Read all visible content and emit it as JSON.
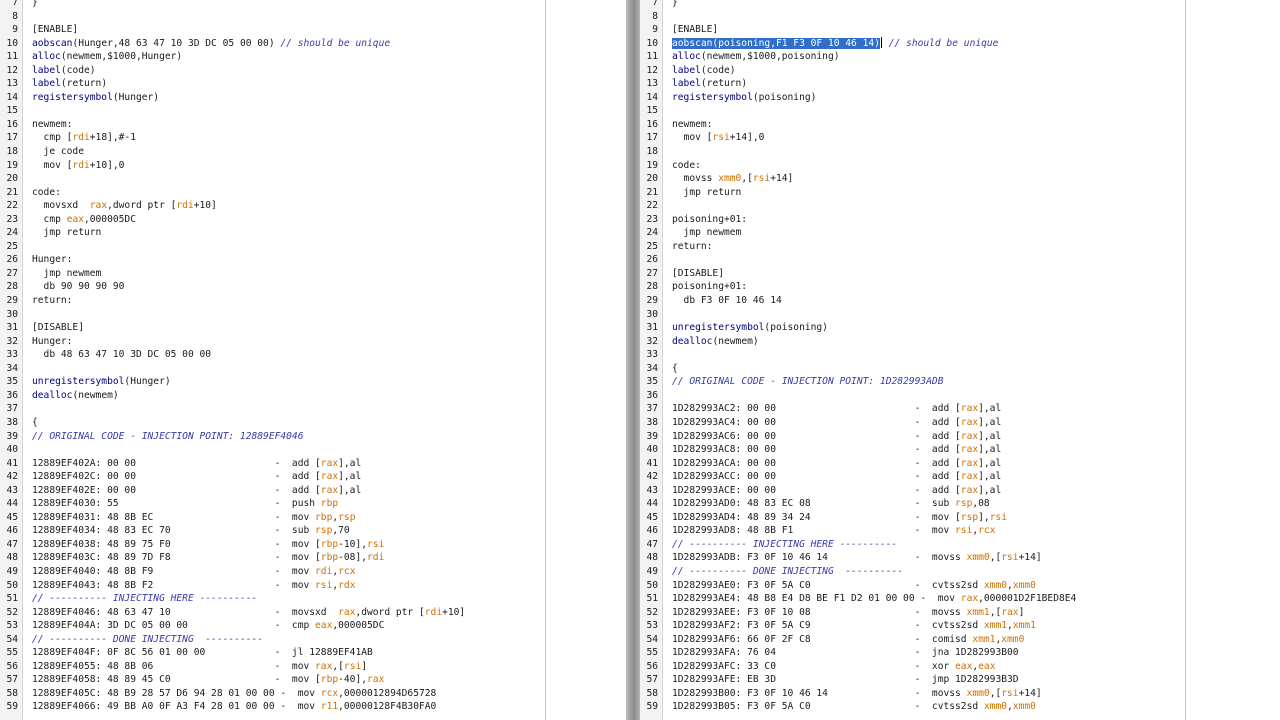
{
  "left_editor": {
    "lines": [
      {
        "n": "7",
        "t": "}"
      },
      {
        "n": "8",
        "t": ""
      },
      {
        "n": "9",
        "t": "[ENABLE]"
      },
      {
        "n": "10",
        "t": "aobscan(Hunger,48 63 47 10 3D DC 05 00 00) // should be unique"
      },
      {
        "n": "11",
        "t": "alloc(newmem,$1000,Hunger)"
      },
      {
        "n": "12",
        "t": "label(code)"
      },
      {
        "n": "13",
        "t": "label(return)"
      },
      {
        "n": "14",
        "t": "registersymbol(Hunger)"
      },
      {
        "n": "15",
        "t": ""
      },
      {
        "n": "16",
        "t": "newmem:"
      },
      {
        "n": "17",
        "t": "  cmp [rdi+18],#-1"
      },
      {
        "n": "18",
        "t": "  je code"
      },
      {
        "n": "19",
        "t": "  mov [rdi+10],0"
      },
      {
        "n": "20",
        "t": ""
      },
      {
        "n": "21",
        "t": "code:"
      },
      {
        "n": "22",
        "t": "  movsxd  rax,dword ptr [rdi+10]"
      },
      {
        "n": "23",
        "t": "  cmp eax,000005DC"
      },
      {
        "n": "24",
        "t": "  jmp return"
      },
      {
        "n": "25",
        "t": ""
      },
      {
        "n": "26",
        "t": "Hunger:"
      },
      {
        "n": "27",
        "t": "  jmp newmem"
      },
      {
        "n": "28",
        "t": "  db 90 90 90 90"
      },
      {
        "n": "29",
        "t": "return:"
      },
      {
        "n": "30",
        "t": ""
      },
      {
        "n": "31",
        "t": "[DISABLE]"
      },
      {
        "n": "32",
        "t": "Hunger:"
      },
      {
        "n": "33",
        "t": "  db 48 63 47 10 3D DC 05 00 00"
      },
      {
        "n": "34",
        "t": ""
      },
      {
        "n": "35",
        "t": "unregistersymbol(Hunger)"
      },
      {
        "n": "36",
        "t": "dealloc(newmem)"
      },
      {
        "n": "37",
        "t": ""
      },
      {
        "n": "38",
        "t": "{"
      },
      {
        "n": "39",
        "t": "// ORIGINAL CODE - INJECTION POINT: 12889EF4046"
      },
      {
        "n": "40",
        "t": ""
      },
      {
        "n": "41",
        "t": "12889EF402A: 00 00                        -  add [rax],al"
      },
      {
        "n": "42",
        "t": "12889EF402C: 00 00                        -  add [rax],al"
      },
      {
        "n": "43",
        "t": "12889EF402E: 00 00                        -  add [rax],al"
      },
      {
        "n": "44",
        "t": "12889EF4030: 55                           -  push rbp"
      },
      {
        "n": "45",
        "t": "12889EF4031: 48 8B EC                     -  mov rbp,rsp"
      },
      {
        "n": "46",
        "t": "12889EF4034: 48 83 EC 70                  -  sub rsp,70"
      },
      {
        "n": "47",
        "t": "12889EF4038: 48 89 75 F0                  -  mov [rbp-10],rsi"
      },
      {
        "n": "48",
        "t": "12889EF403C: 48 89 7D F8                  -  mov [rbp-08],rdi"
      },
      {
        "n": "49",
        "t": "12889EF4040: 48 8B F9                     -  mov rdi,rcx"
      },
      {
        "n": "50",
        "t": "12889EF4043: 48 8B F2                     -  mov rsi,rdx"
      },
      {
        "n": "51",
        "t": "// ---------- INJECTING HERE ----------"
      },
      {
        "n": "52",
        "t": "12889EF4046: 48 63 47 10                  -  movsxd  rax,dword ptr [rdi+10]"
      },
      {
        "n": "53",
        "t": "12889EF404A: 3D DC 05 00 00               -  cmp eax,000005DC"
      },
      {
        "n": "54",
        "t": "// ---------- DONE INJECTING  ----------"
      },
      {
        "n": "55",
        "t": "12889EF404F: 0F 8C 56 01 00 00            -  jl 12889EF41AB"
      },
      {
        "n": "56",
        "t": "12889EF4055: 48 8B 06                     -  mov rax,[rsi]"
      },
      {
        "n": "57",
        "t": "12889EF4058: 48 89 45 C0                  -  mov [rbp-40],rax"
      },
      {
        "n": "58",
        "t": "12889EF405C: 48 B9 28 57 D6 94 28 01 00 00 -  mov rcx,0000012894D65728"
      },
      {
        "n": "59",
        "t": "12889EF4066: 49 BB A0 0F A3 F4 28 01 00 00 -  mov r11,00000128F4B30FA0"
      }
    ]
  },
  "right_editor": {
    "lines": [
      {
        "n": "7",
        "t": "}"
      },
      {
        "n": "8",
        "t": ""
      },
      {
        "n": "9",
        "t": "[ENABLE]"
      },
      {
        "n": "10",
        "t": "aobscan(poisoning,F1 F3 0F 10 46 14) // should be unique"
      },
      {
        "n": "11",
        "t": "alloc(newmem,$1000,poisoning)"
      },
      {
        "n": "12",
        "t": "label(code)"
      },
      {
        "n": "13",
        "t": "label(return)"
      },
      {
        "n": "14",
        "t": "registersymbol(poisoning)"
      },
      {
        "n": "15",
        "t": ""
      },
      {
        "n": "16",
        "t": "newmem:"
      },
      {
        "n": "17",
        "t": "  mov [rsi+14],0"
      },
      {
        "n": "18",
        "t": ""
      },
      {
        "n": "19",
        "t": "code:"
      },
      {
        "n": "20",
        "t": "  movss xmm0,[rsi+14]"
      },
      {
        "n": "21",
        "t": "  jmp return"
      },
      {
        "n": "22",
        "t": ""
      },
      {
        "n": "23",
        "t": "poisoning+01:"
      },
      {
        "n": "24",
        "t": "  jmp newmem"
      },
      {
        "n": "25",
        "t": "return:"
      },
      {
        "n": "26",
        "t": ""
      },
      {
        "n": "27",
        "t": "[DISABLE]"
      },
      {
        "n": "28",
        "t": "poisoning+01:"
      },
      {
        "n": "29",
        "t": "  db F3 0F 10 46 14"
      },
      {
        "n": "30",
        "t": ""
      },
      {
        "n": "31",
        "t": "unregistersymbol(poisoning)"
      },
      {
        "n": "32",
        "t": "dealloc(newmem)"
      },
      {
        "n": "33",
        "t": ""
      },
      {
        "n": "34",
        "t": "{"
      },
      {
        "n": "35",
        "t": "// ORIGINAL CODE - INJECTION POINT: 1D282993ADB"
      },
      {
        "n": "36",
        "t": ""
      },
      {
        "n": "37",
        "t": "1D282993AC2: 00 00                        -  add [rax],al"
      },
      {
        "n": "38",
        "t": "1D282993AC4: 00 00                        -  add [rax],al"
      },
      {
        "n": "39",
        "t": "1D282993AC6: 00 00                        -  add [rax],al"
      },
      {
        "n": "40",
        "t": "1D282993AC8: 00 00                        -  add [rax],al"
      },
      {
        "n": "41",
        "t": "1D282993ACA: 00 00                        -  add [rax],al"
      },
      {
        "n": "42",
        "t": "1D282993ACC: 00 00                        -  add [rax],al"
      },
      {
        "n": "43",
        "t": "1D282993ACE: 00 00                        -  add [rax],al"
      },
      {
        "n": "44",
        "t": "1D282993AD0: 48 83 EC 08                  -  sub rsp,08"
      },
      {
        "n": "45",
        "t": "1D282993AD4: 48 89 34 24                  -  mov [rsp],rsi"
      },
      {
        "n": "46",
        "t": "1D282993AD8: 48 8B F1                     -  mov rsi,rcx"
      },
      {
        "n": "47",
        "t": "// ---------- INJECTING HERE ----------"
      },
      {
        "n": "48",
        "t": "1D282993ADB: F3 0F 10 46 14               -  movss xmm0,[rsi+14]"
      },
      {
        "n": "49",
        "t": "// ---------- DONE INJECTING  ----------"
      },
      {
        "n": "50",
        "t": "1D282993AE0: F3 0F 5A C0                  -  cvtss2sd xmm0,xmm0"
      },
      {
        "n": "51",
        "t": "1D282993AE4: 48 B8 E4 D8 BE F1 D2 01 00 00 -  mov rax,000001D2F1BED8E4"
      },
      {
        "n": "52",
        "t": "1D282993AEE: F3 0F 10 08                  -  movss xmm1,[rax]"
      },
      {
        "n": "53",
        "t": "1D282993AF2: F3 0F 5A C9                  -  cvtss2sd xmm1,xmm1"
      },
      {
        "n": "54",
        "t": "1D282993AF6: 66 0F 2F C8                  -  comisd xmm1,xmm0"
      },
      {
        "n": "55",
        "t": "1D282993AFA: 76 04                        -  jna 1D282993B00"
      },
      {
        "n": "56",
        "t": "1D282993AFC: 33 C0                        -  xor eax,eax"
      },
      {
        "n": "57",
        "t": "1D282993AFE: EB 3D                        -  jmp 1D282993B3D"
      },
      {
        "n": "58",
        "t": "1D282993B00: F3 0F 10 46 14               -  movss xmm0,[rsi+14]"
      },
      {
        "n": "59",
        "t": "1D282993B05: F3 0F 5A C0                  -  cvtss2sd xmm0,xmm0"
      }
    ],
    "selection": {
      "line": "10",
      "text": "aobscan(poisoning,F1 F3 0F 10 46 14)"
    }
  },
  "colors": {
    "selection": "#2f6fc9",
    "comment": "#3a3aa8",
    "number": "#098658",
    "register": "#d07000"
  }
}
